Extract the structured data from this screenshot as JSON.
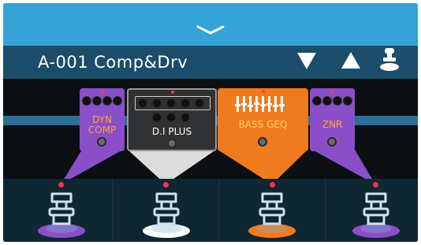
{
  "header": {
    "patch_name": "A-001 Comp&Drv",
    "scroll_icon": "chevron-down-icon",
    "prev_icon": "triangle-down-icon",
    "next_icon": "triangle-up-icon",
    "pedal_icon": "footswitch-icon"
  },
  "effects": [
    {
      "label": "DYN\nCOMP",
      "color": "#8a4fc8",
      "knobs": 4,
      "active": true
    },
    {
      "label": "D.I PLUS",
      "color": "#2f3132",
      "knobs": 8,
      "active": true
    },
    {
      "label": "BASS GEQ",
      "color": "#f07a1e",
      "knobs": 0,
      "active": true
    },
    {
      "label": "ZNR",
      "color": "#8a4fc8",
      "knobs": 4,
      "active": true
    }
  ],
  "footswitches": [
    {
      "color": "#8a4fc8",
      "state": "on"
    },
    {
      "color": "#ffffff",
      "state": "on"
    },
    {
      "color": "#f07a1e",
      "state": "on"
    },
    {
      "color": "#8a4fc8",
      "state": "on"
    }
  ],
  "colors": {
    "accent": "#33a3d8",
    "title_bar": "#1c4d6b",
    "led": "#ff3050"
  }
}
